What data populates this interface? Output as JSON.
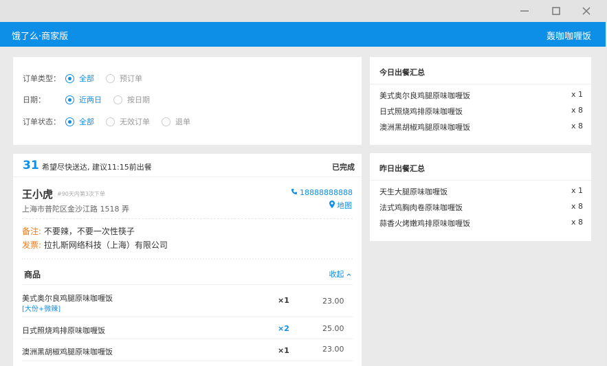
{
  "app": {
    "title": "饿了么·商家版",
    "shop_name": "轰咖咖喱饭"
  },
  "window_controls": {
    "minimize": "minimize-icon",
    "maximize": "maximize-icon",
    "close": "close-icon"
  },
  "filters": {
    "order_type": {
      "label": "订单类型：",
      "options": [
        {
          "label": "全部",
          "selected": true
        },
        {
          "label": "预订单",
          "selected": false
        }
      ]
    },
    "date": {
      "label": "日期：",
      "options": [
        {
          "label": "近两日",
          "selected": true
        },
        {
          "label": "按日期",
          "selected": false
        }
      ]
    },
    "status": {
      "label": "订单状态：",
      "options": [
        {
          "label": "全部",
          "selected": true
        },
        {
          "label": "无效订单",
          "selected": false
        },
        {
          "label": "退单",
          "selected": false
        }
      ]
    }
  },
  "order": {
    "number": "31",
    "tip": "希望尽快送达, 建议11:15前出餐",
    "status": "已完成",
    "customer": {
      "name": "王小虎",
      "note": "#90天内第3次下单",
      "address": "上海市普陀区金沙江路 1518 弄",
      "phone": "18888888888",
      "map_label": "地图"
    },
    "remark": {
      "key": "备注:",
      "value": "不要辣，不要一次性筷子"
    },
    "invoice": {
      "key": "发票:",
      "value": "拉扎斯网络科技（上海）有限公司"
    },
    "goods_title": "商品",
    "collapse_label": "收起",
    "items": [
      {
        "name": "美式奥尔良鸡腿原味咖喱饭",
        "tag": "[大份+微辣]",
        "qty": "×1",
        "price": "23.00"
      },
      {
        "name": "日式照烧鸡排原味咖喱饭",
        "tag": "",
        "qty": "×2",
        "price": "25.00"
      },
      {
        "name": "澳洲黑胡椒鸡腿原味咖喱饭",
        "tag": "",
        "qty": "×1",
        "price": "23.00"
      }
    ]
  },
  "today_summary": {
    "title": "今日出餐汇总",
    "items": [
      {
        "name": "美式奥尔良鸡腿原味咖喱饭",
        "qty": "x 1"
      },
      {
        "name": "日式照烧鸡排原味咖喱饭",
        "qty": "x 8"
      },
      {
        "name": "澳洲黑胡椒鸡腿原味咖喱饭",
        "qty": "x 8"
      }
    ]
  },
  "yesterday_summary": {
    "title": "昨日出餐汇总",
    "items": [
      {
        "name": "天生大腿原味咖喱饭",
        "qty": "x 1"
      },
      {
        "name": "法式鸡胸肉卷原味咖喱饭",
        "qty": "x 8"
      },
      {
        "name": "蒜香火烤嫩鸡排原味咖喱饭",
        "qty": "x 8"
      }
    ]
  },
  "colors": {
    "brand": "#0d8fe8",
    "accent_orange": "#f07d1a"
  }
}
